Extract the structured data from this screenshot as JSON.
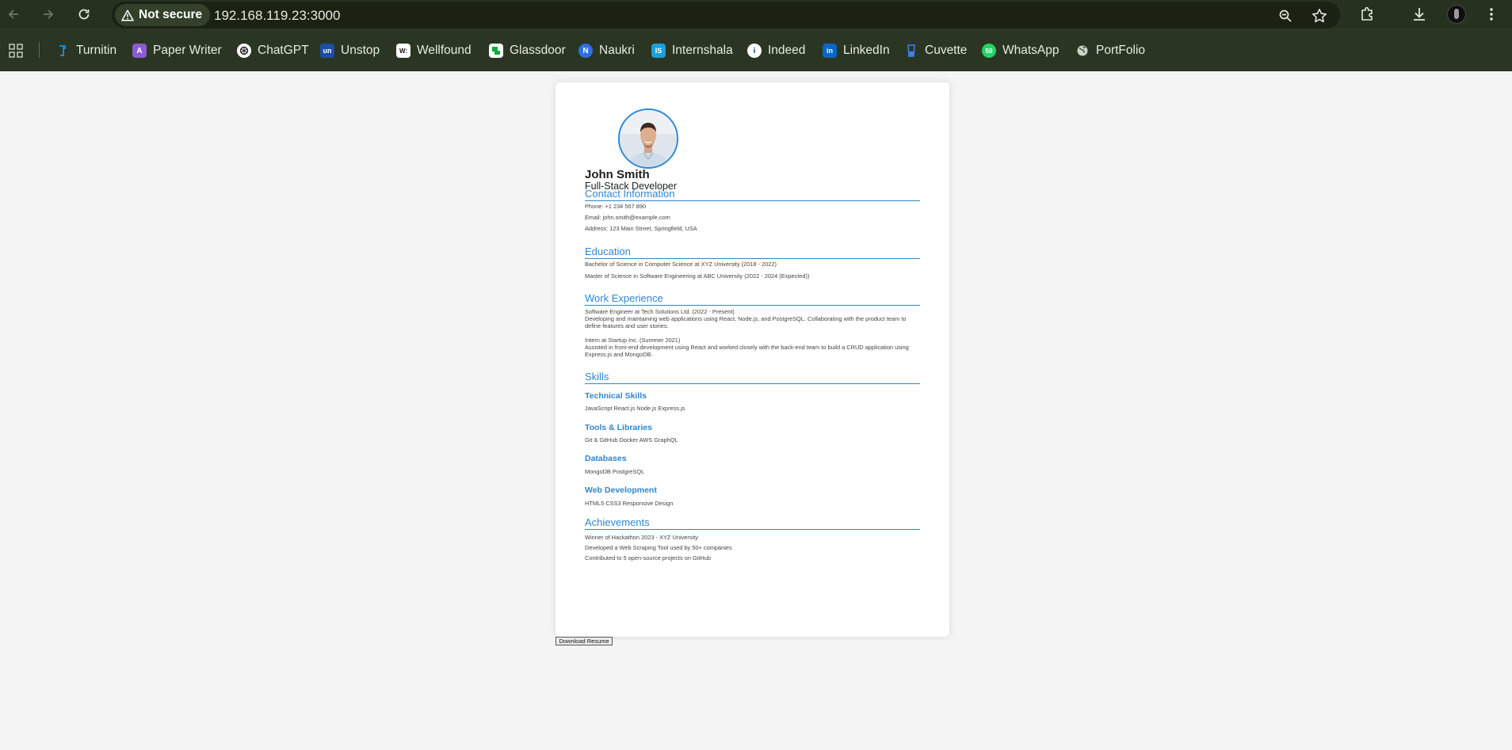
{
  "browser": {
    "security_label": "Not secure",
    "url": "192.168.119.23:3000"
  },
  "bookmarks": [
    {
      "label": "Turnitin",
      "icon": "turnitin-icon",
      "color": "#1a88c8"
    },
    {
      "label": "Paper Writer",
      "icon": "paper-writer-icon",
      "color": "#8a5cd0"
    },
    {
      "label": "ChatGPT",
      "icon": "chatgpt-icon",
      "color": "#ffffff"
    },
    {
      "label": "Unstop",
      "icon": "unstop-icon",
      "color": "#1c4fa0"
    },
    {
      "label": "Wellfound",
      "icon": "wellfound-icon",
      "color": "#ffffff"
    },
    {
      "label": "Glassdoor",
      "icon": "glassdoor-icon",
      "color": "#0caa41"
    },
    {
      "label": "Naukri",
      "icon": "naukri-icon",
      "color": "#2f6fe0"
    },
    {
      "label": "Internshala",
      "icon": "internshala-icon",
      "color": "#1aa0dc"
    },
    {
      "label": "Indeed",
      "icon": "indeed-icon",
      "color": "#ffffff"
    },
    {
      "label": "LinkedIn",
      "icon": "linkedin-icon",
      "color": "#0a66c2"
    },
    {
      "label": "Cuvette",
      "icon": "cuvette-icon",
      "color": "#3b82f6"
    },
    {
      "label": "WhatsApp",
      "icon": "whatsapp-icon",
      "color": "#25d366"
    },
    {
      "label": "PortFolio",
      "icon": "globe-icon",
      "color": "#cfd3cb"
    }
  ],
  "resume": {
    "name": "John Smith",
    "title": "Full-Stack Developer",
    "contact": {
      "heading": "Contact Information",
      "phone": "Phone: +1 234 567 890",
      "email": "Email: john.smith@example.com",
      "address": "Address: 123 Main Street, Springfield, USA"
    },
    "education": {
      "heading": "Education",
      "items": [
        "Bachelor of Science in Computer Science at XYZ University (2018 - 2022)",
        "Master of Science in Software Engineering at ABC University (2022 - 2024 (Expected))"
      ]
    },
    "experience": {
      "heading": "Work Experience",
      "items": [
        {
          "title": "Software Engineer at Tech Solutions Ltd. (2022 - Present)",
          "description": "Developing and maintaining web applications using React, Node.js, and PostgreSQL. Collaborating with the product team to define features and user stories."
        },
        {
          "title": "Intern at Startup Inc. (Summer 2021)",
          "description": "Assisted in front-end development using React and worked closely with the back-end team to build a CRUD application using Express.js and MongoDB."
        }
      ]
    },
    "skills": {
      "heading": "Skills",
      "groups": [
        {
          "name": "Technical Skills",
          "items": "JavaScript React.js Node.js Express.js"
        },
        {
          "name": "Tools & Libraries",
          "items": "Git & GitHub Docker AWS GraphQL"
        },
        {
          "name": "Databases",
          "items": "MongoDB PostgreSQL"
        },
        {
          "name": "Web Development",
          "items": "HTML5 CSS3 Responsive Design"
        }
      ]
    },
    "achievements": {
      "heading": "Achievements",
      "items": [
        "Winner of Hackathon 2023 - XYZ University",
        "Developed a Web Scraping Tool used by 50+ companies",
        "Contributed to 5 open-source projects on GitHub"
      ]
    }
  },
  "download_button": "Download Resume"
}
